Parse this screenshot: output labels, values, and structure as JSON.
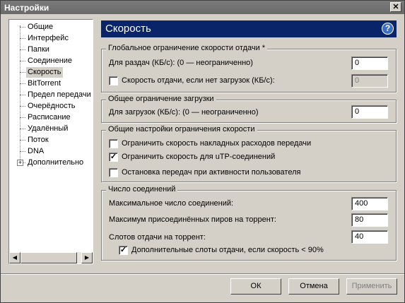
{
  "window": {
    "title": "Настройки",
    "close_label": "✕"
  },
  "sidebar": {
    "items": [
      {
        "label": "Общие"
      },
      {
        "label": "Интерфейс"
      },
      {
        "label": "Папки"
      },
      {
        "label": "Соединение"
      },
      {
        "label": "Скорость",
        "selected": true
      },
      {
        "label": "BitTorrent"
      },
      {
        "label": "Предел передачи"
      },
      {
        "label": "Очерёдность"
      },
      {
        "label": "Расписание"
      },
      {
        "label": "Удалённый"
      },
      {
        "label": "Поток"
      },
      {
        "label": "DNA"
      },
      {
        "label": "Дополнительно",
        "expandable": true
      }
    ],
    "expander": "+"
  },
  "page": {
    "title": "Скорость",
    "help": "?"
  },
  "upload_limit": {
    "title": "Глобальное ограничение скорости отдачи *",
    "seeding_label": "Для раздач (КБ/с): (0 — неограниченно)",
    "seeding_value": "0",
    "no_download_label": "Скорость отдачи, если нет загрузок (КБ/с):",
    "no_download_checked": false,
    "no_download_value": "0"
  },
  "download_limit": {
    "title": "Общее ограничение загрузки",
    "label": "Для загрузок (КБ/с): (0 — неограниченно)",
    "value": "0"
  },
  "general_limits": {
    "title": "Общие настройки ограничения скорости",
    "options": [
      {
        "label": "Ограничить скорость накладных расходов передачи",
        "checked": false
      },
      {
        "label": "Ограничить скорость для uTP-соединений",
        "checked": true
      },
      {
        "label": "Остановка передач при активности пользователя",
        "checked": false
      }
    ]
  },
  "connections": {
    "title": "Число соединений",
    "max_connections_label": "Максимальное число соединений:",
    "max_connections_value": "400",
    "max_peers_label": "Максимум присоединённых пиров на торрент:",
    "max_peers_value": "80",
    "slots_label": "Слотов отдачи на торрент:",
    "slots_value": "40",
    "extra_slots_label": "Дополнительные слоты отдачи, если скорость  < 90%",
    "extra_slots_checked": true
  },
  "buttons": {
    "ok": "ОК",
    "cancel": "Отмена",
    "apply": "Применить"
  }
}
